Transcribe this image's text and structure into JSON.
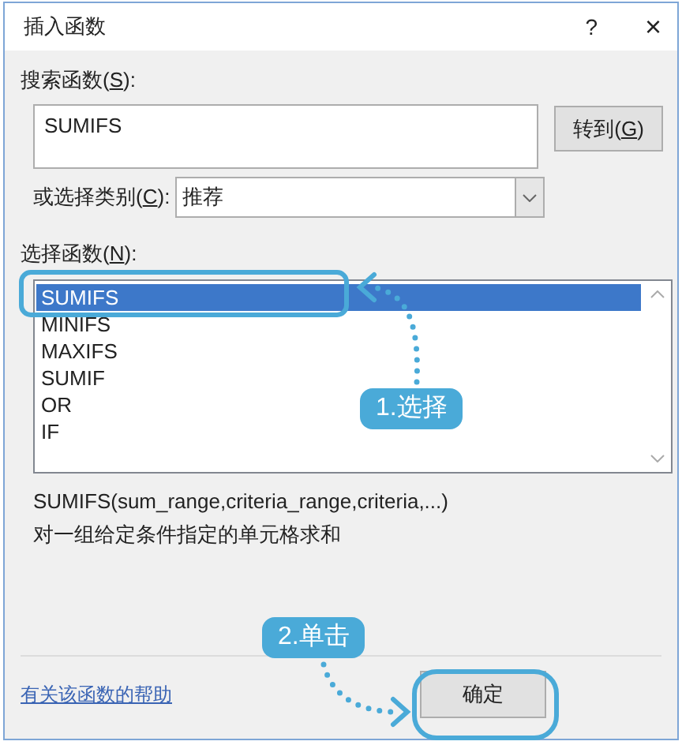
{
  "window": {
    "title": "插入函数",
    "help": "?",
    "close": "×"
  },
  "search": {
    "label": {
      "before": "搜索函数(",
      "key": "S",
      "after": "):"
    },
    "value": "SUMIFS",
    "go_button": {
      "before": "转到(",
      "key": "G",
      "after": ")"
    }
  },
  "category": {
    "label": {
      "before": "或选择类别(",
      "key": "C",
      "after": "):"
    },
    "value": "推荐"
  },
  "functions": {
    "label": {
      "before": "选择函数(",
      "key": "N",
      "after": "):"
    },
    "items": [
      {
        "name": "SUMIFS",
        "selected": true
      },
      {
        "name": "MINIFS",
        "selected": false
      },
      {
        "name": "MAXIFS",
        "selected": false
      },
      {
        "name": "SUMIF",
        "selected": false
      },
      {
        "name": "OR",
        "selected": false
      },
      {
        "name": "IF",
        "selected": false
      }
    ]
  },
  "signature": "SUMIFS(sum_range,criteria_range,criteria,...)",
  "description": "对一组给定条件指定的单元格求和",
  "help_link": "有关该函数的帮助",
  "ok_button": "确定",
  "annotations": [
    {
      "text": "1.选择"
    },
    {
      "text": "2.单击"
    }
  ]
}
